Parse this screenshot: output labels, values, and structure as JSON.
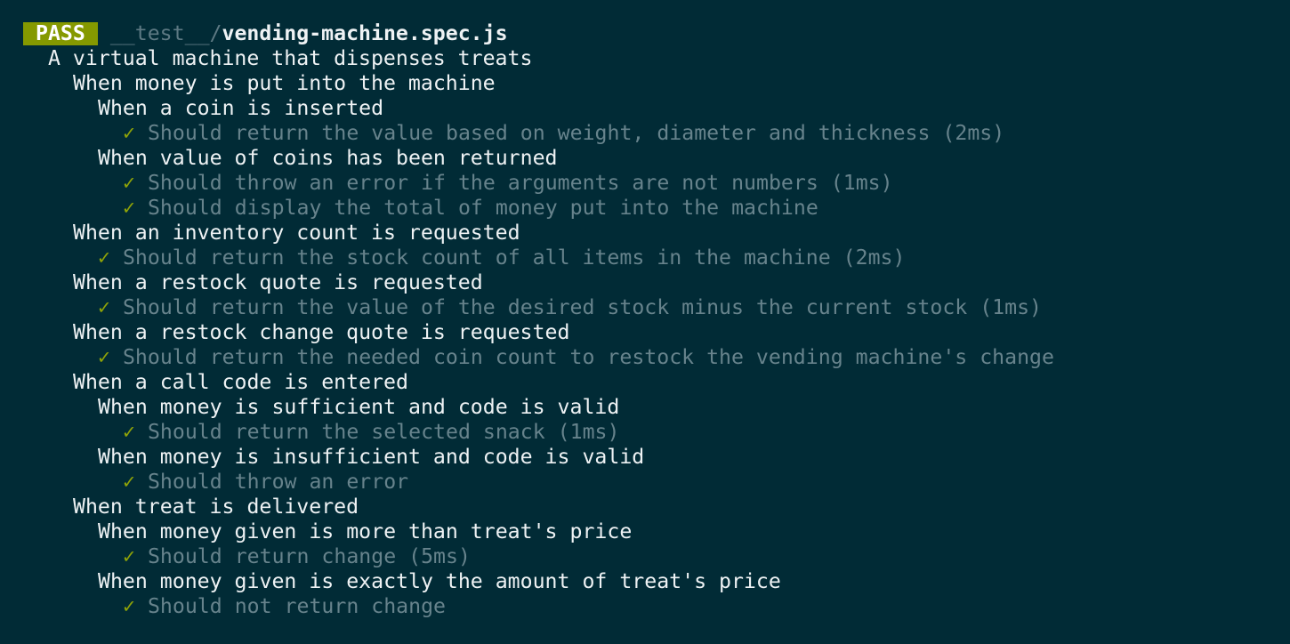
{
  "header": {
    "status": "PASS",
    "path_dir": "__test__/",
    "file": "vending-machine.spec.js"
  },
  "check_glyph": "✓",
  "colors": {
    "background": "#012b36",
    "pass_badge": "#859900",
    "check": "#8fa308",
    "describe_text": "#eef2f4",
    "test_text": "#67838c"
  },
  "lines": [
    {
      "type": "describe",
      "level": 1,
      "text": "A virtual machine that dispenses treats"
    },
    {
      "type": "describe",
      "level": 2,
      "text": "When money is put into the machine"
    },
    {
      "type": "describe",
      "level": 3,
      "text": "When a coin is inserted"
    },
    {
      "type": "test",
      "level": 4,
      "text": "Should return the value based on weight, diameter and thickness (2ms)"
    },
    {
      "type": "describe",
      "level": 3,
      "text": "When value of coins has been returned"
    },
    {
      "type": "test",
      "level": 4,
      "text": "Should throw an error if the arguments are not numbers (1ms)"
    },
    {
      "type": "test",
      "level": 4,
      "text": "Should display the total of money put into the machine"
    },
    {
      "type": "describe",
      "level": 2,
      "text": "When an inventory count is requested"
    },
    {
      "type": "test",
      "level": 3,
      "text": "Should return the stock count of all items in the machine (2ms)"
    },
    {
      "type": "describe",
      "level": 2,
      "text": "When a restock quote is requested"
    },
    {
      "type": "test",
      "level": 3,
      "text": "Should return the value of the desired stock minus the current stock (1ms)"
    },
    {
      "type": "describe",
      "level": 2,
      "text": "When a restock change quote is requested"
    },
    {
      "type": "test",
      "level": 3,
      "text": "Should return the needed coin count to restock the vending machine's change"
    },
    {
      "type": "describe",
      "level": 2,
      "text": "When a call code is entered"
    },
    {
      "type": "describe",
      "level": 3,
      "text": "When money is sufficient and code is valid"
    },
    {
      "type": "test",
      "level": 4,
      "text": "Should return the selected snack (1ms)"
    },
    {
      "type": "describe",
      "level": 3,
      "text": "When money is insufficient and code is valid"
    },
    {
      "type": "test",
      "level": 4,
      "text": "Should throw an error"
    },
    {
      "type": "describe",
      "level": 2,
      "text": "When treat is delivered"
    },
    {
      "type": "describe",
      "level": 3,
      "text": "When money given is more than treat's price"
    },
    {
      "type": "test",
      "level": 4,
      "text": "Should return change (5ms)"
    },
    {
      "type": "describe",
      "level": 3,
      "text": "When money given is exactly the amount of treat's price"
    },
    {
      "type": "test",
      "level": 4,
      "text": "Should not return change"
    }
  ]
}
